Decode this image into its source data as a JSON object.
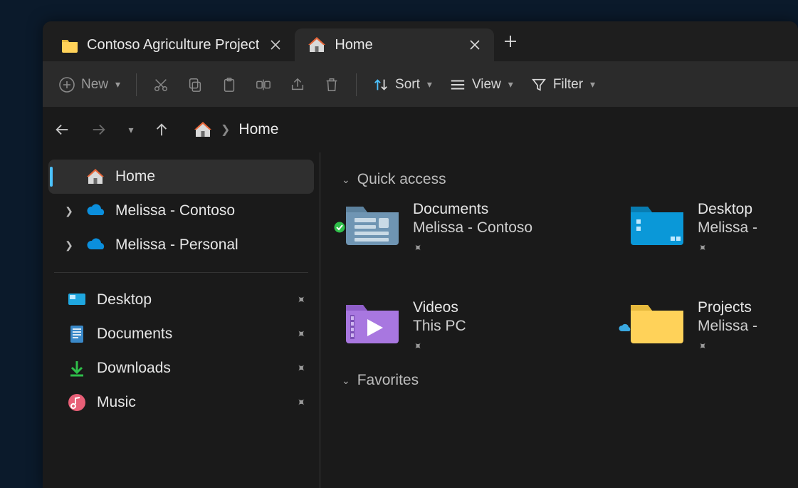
{
  "tabs": [
    {
      "label": "Contoso Agriculture Project",
      "icon": "folder",
      "active": false
    },
    {
      "label": "Home",
      "icon": "home",
      "active": true
    }
  ],
  "toolbar": {
    "new_label": "New",
    "sort_label": "Sort",
    "view_label": "View",
    "filter_label": "Filter"
  },
  "breadcrumb": {
    "location": "Home"
  },
  "sidebar": {
    "top": [
      {
        "label": "Home",
        "icon": "home",
        "expandable": false,
        "active": true
      },
      {
        "label": "Melissa - Contoso",
        "icon": "onedrive",
        "expandable": true,
        "active": false
      },
      {
        "label": "Melissa - Personal",
        "icon": "onedrive",
        "expandable": true,
        "active": false
      }
    ],
    "pinned": [
      {
        "label": "Desktop",
        "icon": "desktop"
      },
      {
        "label": "Documents",
        "icon": "documents"
      },
      {
        "label": "Downloads",
        "icon": "downloads"
      },
      {
        "label": "Music",
        "icon": "music"
      }
    ]
  },
  "sections": {
    "quick_access_label": "Quick access",
    "favorites_label": "Favorites"
  },
  "quick_access": [
    {
      "title": "Documents",
      "subtitle": "Melissa - Contoso",
      "icon": "documents-folder",
      "badge": "sync-ok"
    },
    {
      "title": "Desktop",
      "subtitle": "Melissa -",
      "icon": "desktop-folder",
      "badge": null
    },
    {
      "title": "Videos",
      "subtitle": "This PC",
      "icon": "videos-folder",
      "badge": null
    },
    {
      "title": "Projects",
      "subtitle": "Melissa -",
      "icon": "projects-folder",
      "badge": "cloud"
    }
  ]
}
